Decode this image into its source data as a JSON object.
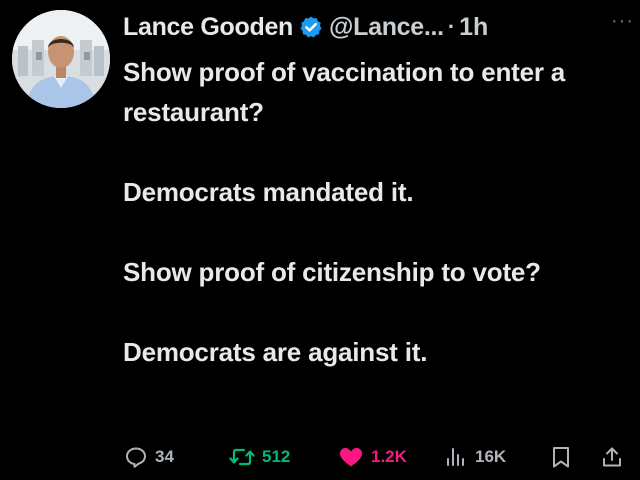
{
  "author": {
    "name": "Lance Gooden",
    "handle": "@Lance...",
    "separator": "·",
    "time": "1h",
    "verified_color": "#1d9bf0",
    "avatar_icon": "profile-photo"
  },
  "more_label": "···",
  "tweet": {
    "paragraphs": [
      "Show proof of vaccination to enter a restaurant?",
      "Democrats mandated it.",
      "Show proof of citizenship to vote?",
      "Democrats are against it."
    ]
  },
  "actions": {
    "replies": "34",
    "reposts": "512",
    "likes": "1.2K",
    "views": "16K",
    "repost_color": "#00ba7c",
    "like_color": "#f91880"
  }
}
